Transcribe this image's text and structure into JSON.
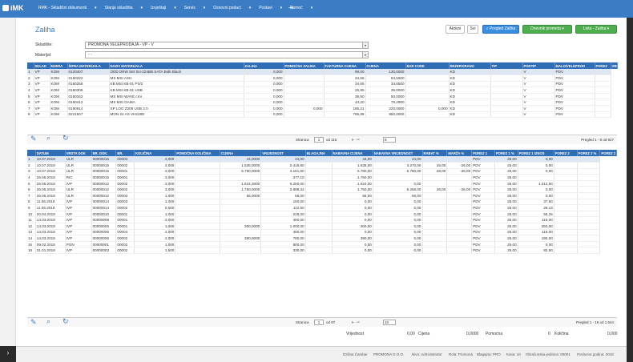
{
  "app": {
    "logo": "iMK",
    "menu": [
      "RMK - Skladišni dokumenti",
      "Stanje skladišta",
      "Izvještaji",
      "Servis",
      "Osnovni podaci",
      "Postavi",
      "Pomoć"
    ],
    "exit_icon": "exit-icon"
  },
  "page": {
    "title": "Zaliha"
  },
  "toolbar": {
    "active": "Aktivni",
    "all": "Svi",
    "search": "Pregled Zaliha",
    "dnevnik": "Dnevnik prometa",
    "lista": "Lista - Zaliha"
  },
  "filters": {
    "skladiste_label": "Skladište:",
    "skladiste_value": "PROMONA VELEPRODAJA - VP - V",
    "materijal_label": "Materijal:",
    "materijal_value": "- -"
  },
  "top_table": {
    "headers": [
      "SKLAD",
      "MJERA",
      "ŠIFRA MATERIJALA",
      "NAZIV MATERIJALA",
      "ZALIHA",
      "POMOĆNA ZALIHA",
      "FAKTURNA CIJENA",
      "CIJENA",
      "BAR CODE",
      "REZERVIRANO",
      "TIP",
      "PODTIP",
      "MALO/VELEPROD",
      "POREZ",
      "VREDN"
    ],
    "rows": [
      [
        "1",
        "VP",
        "KOM",
        "0120407",
        "ODD DRW SM SH-224BB SATA Bulk Black",
        "0,000",
        "",
        "99,00",
        "130,0000",
        "",
        "KD",
        "",
        "V",
        "PDV",
        ""
      ],
      [
        "2",
        "VP",
        "KOM",
        "0160222",
        "MS MSI ASH",
        "0,000",
        "",
        "34,56",
        "64,5600",
        "",
        "KD",
        "",
        "V",
        "PDV",
        ""
      ],
      [
        "3",
        "VP",
        "KOM",
        "0160258",
        "KB MSI KB-01 PS/2",
        "0,000",
        "",
        "34,65",
        "34,6500",
        "",
        "KD",
        "",
        "V",
        "PDV",
        ""
      ],
      [
        "4",
        "VP",
        "KOM",
        "0160305",
        "KB MSI KB-01 USB",
        "0,000",
        "",
        "26,95",
        "35,0000",
        "",
        "KD",
        "",
        "V",
        "PDV",
        ""
      ],
      [
        "5",
        "VP",
        "KOM",
        "0160342",
        "MS MSI WAVE crni",
        "0,000",
        "",
        "38,50",
        "50,0000",
        "",
        "KD",
        "",
        "V",
        "PDV",
        ""
      ],
      [
        "6",
        "VP",
        "KOM",
        "0160412",
        "MS MSI GAMA",
        "0,000",
        "",
        "43,20",
        "76,2900",
        "",
        "KD",
        "",
        "V",
        "PDV",
        ""
      ],
      [
        "7",
        "VP",
        "KOM",
        "0190914",
        "SP LOG Z205 USB 2.0",
        "0,000",
        "0,000",
        "185,21",
        "220,0000",
        "0,000",
        "KD",
        "",
        "V",
        "PDV",
        ""
      ],
      [
        "8",
        "VP",
        "KOM",
        "0221507",
        "MON 22 AS VH228D",
        "0,000",
        "",
        "755,99",
        "850,0000",
        "",
        "KD",
        "",
        "V",
        "PDV",
        ""
      ]
    ],
    "pager": {
      "page_label": "Stranica",
      "page": "1",
      "of": "od 116",
      "size": "8",
      "info": "Pregled 1 - 8 od 927"
    }
  },
  "bottom_table": {
    "headers": [
      "DATUM",
      "VRSTA DOK",
      "BR. DOK.",
      "BR.",
      "KOLIČINA",
      "POMOĆNA KOLIČINA",
      "CIJENA",
      "VRIJEDNOST",
      "BLAGAJNA",
      "NABAVNA CIJENA",
      "NABAVNA VRIJEDNOST",
      "RABAT %",
      "MARŽA %",
      "POREZ 1",
      "POREZ 1 %",
      "POREZ 1 IZNOS",
      "POREZ 2",
      "POREZ 2 %",
      "POREZ 2"
    ],
    "rows": [
      [
        "1",
        "10.07.2018",
        "ULR",
        "00000015",
        "00003",
        "2,000",
        "",
        "44,0000",
        "44,00",
        "",
        "44,00",
        "44,00",
        "",
        "",
        "PDV",
        "25,00",
        "0,00",
        "",
        ""
      ],
      [
        "2",
        "10.07.2018",
        "ULR",
        "00000015",
        "00002",
        "2,000",
        "",
        "1.635,0000",
        "2.419,80",
        "",
        "1.635,00",
        "3.270,00",
        "26,00",
        "-26,00",
        "PDV",
        "25,00",
        "0,00",
        "",
        ""
      ],
      [
        "3",
        "10.07.2018",
        "ULR",
        "00000015",
        "00001",
        "2,000",
        "",
        "5.780,0000",
        "4.161,60",
        "",
        "5.780,00",
        "5.780,00",
        "28,00",
        "-28,00",
        "PDV",
        "25,00",
        "0,00",
        "",
        ""
      ],
      [
        "4",
        "26.06.2018",
        "RIC",
        "00000015",
        "00001",
        "3,000",
        "",
        "",
        "377,10",
        "",
        "1.750,00",
        "",
        "",
        "",
        "PDV",
        "25,00",
        "",
        "",
        ""
      ],
      [
        "5",
        "26.06.2018",
        "IVP",
        "00000012",
        "00002",
        "3,000",
        "",
        "1.624,3000",
        "5.250,00",
        "",
        "1.624,30",
        "0,00",
        "",
        "",
        "PDV",
        "25,00",
        "1.312,50",
        "",
        ""
      ],
      [
        "6",
        "26.06.2018",
        "ULR",
        "00000012",
        "00002",
        "3,000",
        "",
        "1.750,0000",
        "3.898,32",
        "",
        "1.750,00",
        "5.268,00",
        "26,00",
        "-26,00",
        "PDV",
        "25,00",
        "0,00",
        "",
        ""
      ],
      [
        "7",
        "26.06.2018",
        "ULR",
        "00000012",
        "00003",
        "1,000",
        "",
        "56,0000",
        "56,00",
        "",
        "56,00",
        "56,00",
        "",
        "",
        "PDV",
        "25,00",
        "0,00",
        "",
        ""
      ],
      [
        "8",
        "11.06.2018",
        "IVP",
        "00000014",
        "00003",
        "1,000",
        "",
        "",
        "150,00",
        "",
        "0,00",
        "0,00",
        "",
        "",
        "PDV",
        "25,00",
        "37,50",
        "",
        ""
      ],
      [
        "9",
        "11.06.2018",
        "IVP",
        "00000014",
        "00002",
        "0,500",
        "",
        "",
        "112,50",
        "",
        "0,00",
        "0,00",
        "",
        "",
        "PDV",
        "25,00",
        "28,13",
        "",
        ""
      ],
      [
        "10",
        "20.04.2018",
        "IVP",
        "00000010",
        "00001",
        "1,000",
        "",
        "",
        "225,00",
        "",
        "0,00",
        "0,00",
        "",
        "",
        "PDV",
        "25,00",
        "56,25",
        "",
        ""
      ],
      [
        "11",
        "14.03.2018",
        "IVP",
        "00000008",
        "00001",
        "2,000",
        "",
        "",
        "460,00",
        "",
        "0,00",
        "0,00",
        "",
        "",
        "PDV",
        "25,00",
        "115,00",
        "",
        ""
      ],
      [
        "12",
        "14.03.2018",
        "IVP",
        "00000005",
        "00001",
        "1,000",
        "",
        "300,0000",
        "1.000,00",
        "",
        "300,00",
        "0,00",
        "",
        "",
        "PDV",
        "25,00",
        "250,00",
        "",
        ""
      ],
      [
        "13",
        "14.03.2018",
        "IVP",
        "00000006",
        "00004",
        "2,000",
        "",
        "",
        "460,00",
        "",
        "0,00",
        "0,00",
        "",
        "",
        "PDV",
        "25,00",
        "115,00",
        "",
        ""
      ],
      [
        "14",
        "14.03.2018",
        "IVP",
        "00000006",
        "00002",
        "2,000",
        "",
        "390,0000",
        "780,00",
        "",
        "390,00",
        "0,00",
        "",
        "",
        "PDV",
        "25,00",
        "195,00",
        "",
        ""
      ],
      [
        "15",
        "09.02.2018",
        "PON",
        "00000001",
        "00002",
        "1,000",
        "",
        "",
        "800,00",
        "",
        "0,00",
        "0,00",
        "",
        "",
        "PDV",
        "25,00",
        "0,00",
        "",
        ""
      ],
      [
        "16",
        "31.01.2018",
        "IVP",
        "00000003",
        "00002",
        "1,500",
        "",
        "",
        "330,00",
        "",
        "0,00",
        "0,00",
        "",
        "",
        "PDV",
        "25,00",
        "82,50",
        "",
        ""
      ]
    ],
    "pager": {
      "page_label": "Stranica",
      "page": "1",
      "of": "od 97",
      "size": "16",
      "info": "Pregled 1 - 16 od 1.544"
    }
  },
  "totals": {
    "vrijednost_label": "Vrijednost",
    "vrijednost": "0,00",
    "cijena_label": "Cijena",
    "cijena": "0,0000",
    "pomocna_label": "Pomoćna",
    "pomocna": "0",
    "kolicina_label": "Količina",
    "kolicina": "0,000"
  },
  "footer": {
    "user": "Dzilina Čambar",
    "company": "PROMONA D.O.O.",
    "nivo": "Nivo: Administrator",
    "rola": "Rola: Promona",
    "blagajna": "Blagajna: PRO",
    "kasa": "Kasa: 10",
    "obracunska": "Obračunska jedinica: 00001",
    "poslovna": "Poslovna godina: 2018"
  },
  "colors": {
    "accent": "#3a7dc4",
    "header": "#2f6db5"
  }
}
